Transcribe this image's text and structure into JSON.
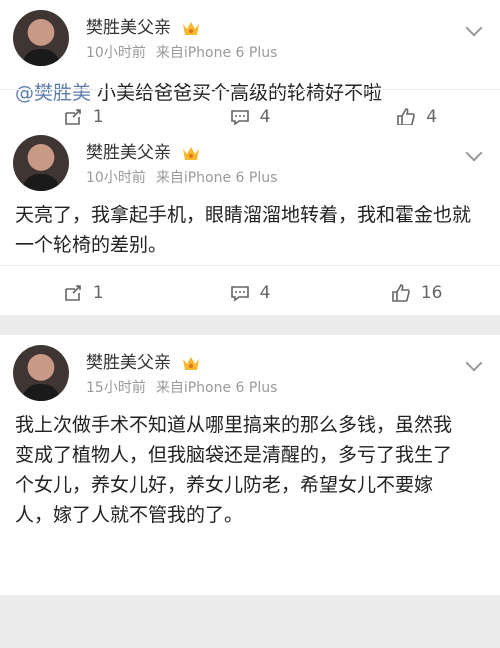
{
  "posts": [
    {
      "author": "樊胜美父亲",
      "time": "10小时前",
      "source": "来自iPhone 6 Plus",
      "mention": "@樊胜美",
      "text": " 小美给爸爸买个高级的轮椅好不啦",
      "reposts": "1",
      "comments": "4",
      "likes": "4"
    },
    {
      "author": "樊胜美父亲",
      "time": "10小时前",
      "source": "来自iPhone 6 Plus",
      "text": "天亮了，我拿起手机，眼睛溜溜地转着，我和霍金也就一个轮椅的差别。",
      "reposts": "1",
      "comments": "4",
      "likes": "16"
    },
    {
      "author": "樊胜美父亲",
      "time": "15小时前",
      "source": "来自iPhone 6 Plus",
      "text": "我上次做手术不知道从哪里搞来的那么多钱，虽然我变成了植物人，但我脑袋还是清醒的，多亏了我生了个女儿，养女儿好，养女儿防老，希望女儿不要嫁人，嫁了人就不管我的了。"
    }
  ],
  "icons": {
    "repost": "repost-icon",
    "comment": "comment-icon",
    "like": "thumbs-up-icon",
    "vip": "vip-crown-icon"
  },
  "colors": {
    "mention": "#5b7cb0",
    "meta": "#9a9a9a",
    "background": "#ececec"
  }
}
